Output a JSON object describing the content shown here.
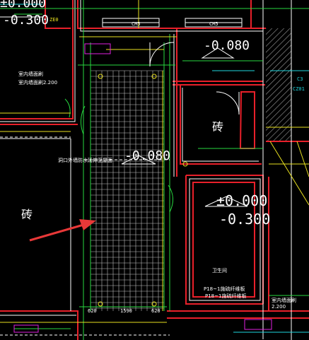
{
  "colors": {
    "background": "#000000",
    "wall_red": "#e8202a",
    "wall_white": "#ffffff",
    "grid_white": "#d8d8d8",
    "line_green": "#28d840",
    "line_yellow": "#e8e020",
    "line_cyan": "#20d8e0",
    "line_magenta": "#e020e0",
    "arrow_red": "#e83838",
    "hatch_gray": "#9a9a9a"
  },
  "levels": {
    "top_left_upper": "±0.000",
    "top_left_lower": "-0.300",
    "room_right_upper": "-0.080",
    "center": "-0.080",
    "bath_upper": "±0.000",
    "bath_lower": "-0.300"
  },
  "labels": {
    "brick_right": "砖",
    "brick_left": "砖",
    "top_dim_a": "CM5",
    "top_dim_b": "CM5",
    "left_dim": "ZE0",
    "right_top_code": "C3",
    "right_top_code2": "CZ01",
    "bath_note_a": "P18~1施硫纤维板",
    "bath_note_b": "卫生间",
    "right_bottom_note": "室内墙面刷2.200",
    "left_note_a": "室内墙面刷",
    "left_note_b": "室内墙面刷2.200",
    "center_note": "洞口外墙防水延伸至屋面",
    "bottom_dim_a": "620",
    "bottom_dim_b": "1590",
    "bottom_dim_c": "620",
    "bath_dim": "P18~1施硫纤维板"
  }
}
